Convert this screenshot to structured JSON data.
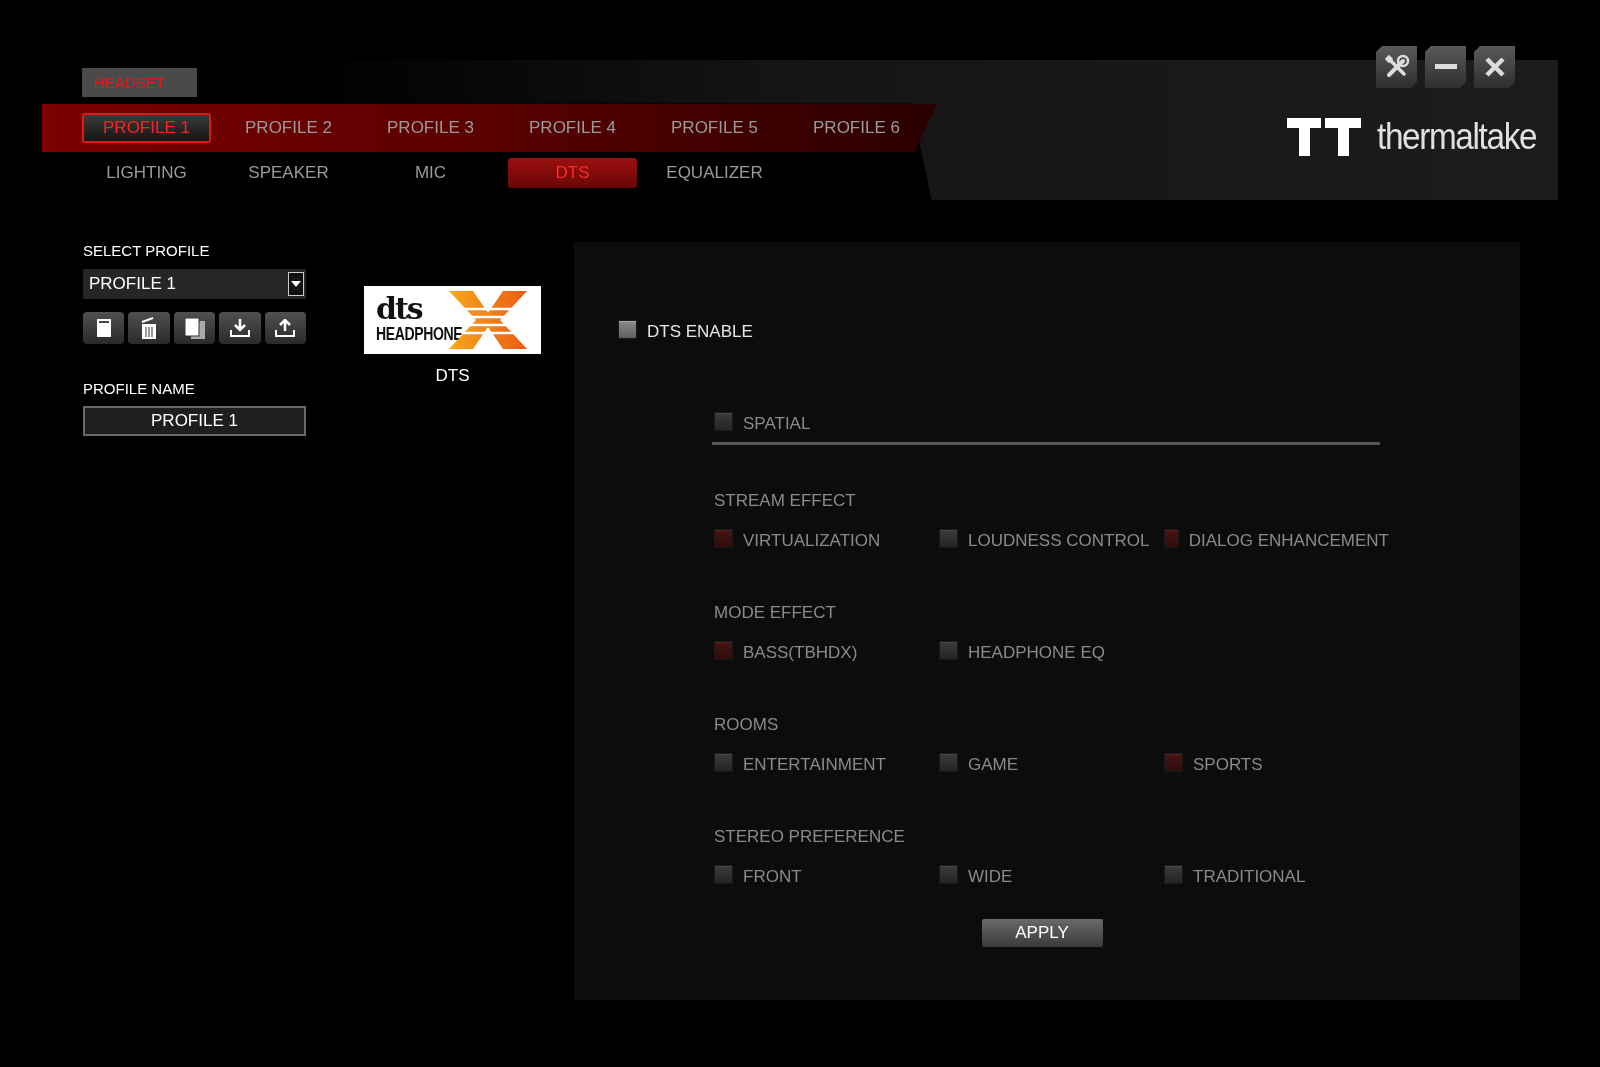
{
  "device_tab": {
    "label": "HEADSET",
    "selected": true
  },
  "profile_tabs": [
    {
      "label": "PROFILE 1",
      "selected": true
    },
    {
      "label": "PROFILE 2",
      "selected": false
    },
    {
      "label": "PROFILE 3",
      "selected": false
    },
    {
      "label": "PROFILE 4",
      "selected": false
    },
    {
      "label": "PROFILE 5",
      "selected": false
    },
    {
      "label": "PROFILE 6",
      "selected": false
    }
  ],
  "section_tabs": [
    {
      "label": "LIGHTING",
      "selected": false
    },
    {
      "label": "SPEAKER",
      "selected": false
    },
    {
      "label": "MIC",
      "selected": false
    },
    {
      "label": "DTS",
      "selected": true
    },
    {
      "label": "EQUALIZER",
      "selected": false
    }
  ],
  "brand": {
    "wordmark": "thermaltake"
  },
  "select_profile": {
    "label": "SELECT PROFILE",
    "value": "PROFILE 1"
  },
  "profile_name": {
    "label": "PROFILE NAME",
    "value": "PROFILE 1"
  },
  "dts_badge": {
    "wordmark": "dts",
    "subtitle": "HEADPHONE",
    "caption": "DTS"
  },
  "dts_enable": {
    "label": "DTS ENABLE",
    "checked": false
  },
  "spatial": {
    "label": "SPATIAL",
    "checked": false
  },
  "groups": [
    {
      "title": "STREAM EFFECT",
      "options": [
        {
          "label": "VIRTUALIZATION",
          "checked": true
        },
        {
          "label": "LOUDNESS CONTROL",
          "checked": false
        },
        {
          "label": "DIALOG ENHANCEMENT",
          "checked": true
        }
      ]
    },
    {
      "title": "MODE EFFECT",
      "options": [
        {
          "label": "BASS(TBHDX)",
          "checked": true
        },
        {
          "label": "HEADPHONE EQ",
          "checked": false
        }
      ]
    },
    {
      "title": "ROOMS",
      "options": [
        {
          "label": "ENTERTAINMENT",
          "checked": false
        },
        {
          "label": "GAME",
          "checked": false
        },
        {
          "label": "SPORTS",
          "checked": true
        }
      ]
    },
    {
      "title": "STEREO PREFERENCE",
      "options": [
        {
          "label": "FRONT",
          "checked": false
        },
        {
          "label": "WIDE",
          "checked": false
        },
        {
          "label": "TRADITIONAL",
          "checked": false
        }
      ]
    }
  ],
  "apply_button": {
    "label": "APPLY"
  }
}
